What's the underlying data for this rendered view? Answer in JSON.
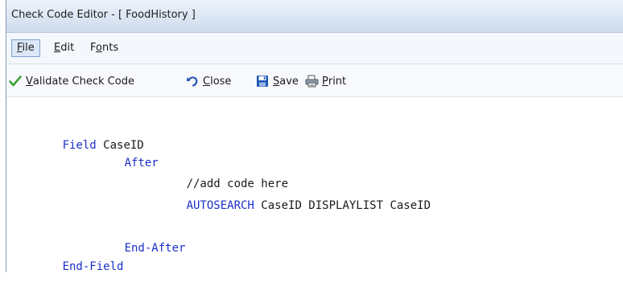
{
  "window": {
    "title": "Check Code Editor - [ FoodHistory ]"
  },
  "menu": {
    "file": {
      "hotkey": "F",
      "rest": "ile"
    },
    "edit": {
      "hotkey": "E",
      "rest": "dit"
    },
    "fonts": {
      "pre": "F",
      "hotkey": "o",
      "rest": "nts"
    }
  },
  "toolbar": {
    "validate": {
      "hotkey": "V",
      "rest": "alidate Check Code",
      "icon": "checkmark-icon"
    },
    "close": {
      "hotkey": "C",
      "rest": "lose",
      "icon": "undo-arrow-icon"
    },
    "save": {
      "hotkey": "S",
      "rest": "ave",
      "icon": "floppy-disk-icon"
    },
    "print": {
      "hotkey": "P",
      "rest": "rint",
      "icon": "printer-icon"
    }
  },
  "code": {
    "l1_kw": "Field",
    "l1_tx": " CaseID",
    "l2_kw": "After",
    "l3_tx": "//add code here",
    "l4_kw": "AUTOSEARCH",
    "l4_tx": " CaseID DISPLAYLIST CaseID",
    "l5_kw": "End-After",
    "l6_kw": "End-Field"
  },
  "colors": {
    "keyword": "#1a2fc8",
    "validate_check": "#3aa33a",
    "accent": "#7da2ce"
  }
}
